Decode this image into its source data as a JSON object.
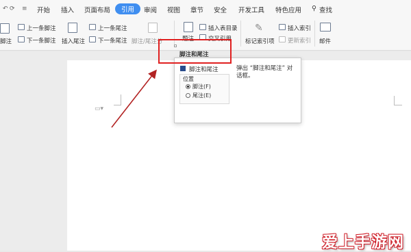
{
  "quick_access": {
    "undo": "↶",
    "redo": "⟳",
    "more": "≡"
  },
  "tabs": [
    {
      "label": "开始"
    },
    {
      "label": "插入"
    },
    {
      "label": "页面布局"
    },
    {
      "label": "引用",
      "active": true
    },
    {
      "label": "审阅"
    },
    {
      "label": "视图"
    },
    {
      "label": "章节"
    },
    {
      "label": "安全"
    },
    {
      "label": "开发工具"
    },
    {
      "label": "特色应用"
    }
  ],
  "search": {
    "label": "查找"
  },
  "ribbon": {
    "footnote_partial": "脚注",
    "prev_footnote": "上一条脚注",
    "next_footnote": "下一条脚注",
    "insert_endnote": "插入尾注",
    "prev_endnote": "上一条尾注",
    "next_endnote": "下一条尾注",
    "footnote_endnote_sep": "脚注/尾注分",
    "caption": "题注",
    "insert_table_of_figures": "插入表目录",
    "cross_reference": "交叉引用",
    "mark_index_entry": "标记索引项",
    "insert_index": "插入索引",
    "update_index": "更新索引",
    "mail": "邮件"
  },
  "popup": {
    "title": "脚注和尾注",
    "item_label": "脚注和尾注",
    "description_line1": "弹出 “脚注和尾注” 对",
    "description_line2": "话框。",
    "position_label": "位置",
    "option_footnote": "脚注(F)",
    "option_endnote": "尾注(E)",
    "selected": "footnote"
  },
  "watermark": {
    "text": "爱上手游网"
  },
  "colors": {
    "accent": "#3f8ef0",
    "highlight_box": "#e02020",
    "arrow": "#b22222"
  }
}
